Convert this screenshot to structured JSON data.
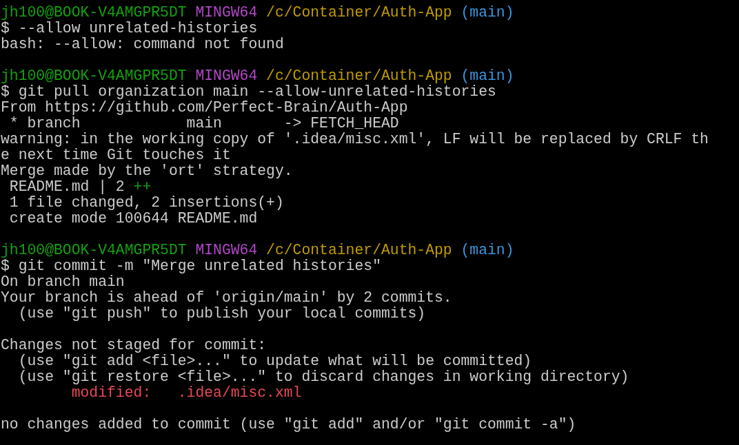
{
  "terminal": {
    "lines": [
      {
        "kind": "prompt",
        "user": "jh100@BOOK-V4AMGPR5DT",
        "system": "MINGW64",
        "path": "/c/Container/Auth-App",
        "branch": "(main)"
      },
      {
        "kind": "command",
        "symbol": "$",
        "text": "--allow unrelated-histories"
      },
      {
        "kind": "output",
        "text": "bash: --allow: command not found"
      },
      {
        "kind": "blank"
      },
      {
        "kind": "prompt",
        "user": "jh100@BOOK-V4AMGPR5DT",
        "system": "MINGW64",
        "path": "/c/Container/Auth-App",
        "branch": "(main)"
      },
      {
        "kind": "command",
        "symbol": "$",
        "text": "git pull organization main --allow-unrelated-histories"
      },
      {
        "kind": "output",
        "text": "From https://github.com/Perfect-Brain/Auth-App"
      },
      {
        "kind": "output",
        "text": " * branch            main       -> FETCH_HEAD"
      },
      {
        "kind": "output",
        "text": "warning: in the working copy of '.idea/misc.xml', LF will be replaced by CRLF th"
      },
      {
        "kind": "output",
        "text": "e next time Git touches it"
      },
      {
        "kind": "output",
        "text": "Merge made by the 'ort' strategy."
      },
      {
        "kind": "stat",
        "text": " README.md | 2",
        "bar": "++"
      },
      {
        "kind": "output",
        "text": " 1 file changed, 2 insertions(+)"
      },
      {
        "kind": "output",
        "text": " create mode 100644 README.md"
      },
      {
        "kind": "blank"
      },
      {
        "kind": "prompt",
        "user": "jh100@BOOK-V4AMGPR5DT",
        "system": "MINGW64",
        "path": "/c/Container/Auth-App",
        "branch": "(main)"
      },
      {
        "kind": "command",
        "symbol": "$",
        "text": "git commit -m \"Merge unrelated histories\""
      },
      {
        "kind": "output",
        "text": "On branch main"
      },
      {
        "kind": "output",
        "text": "Your branch is ahead of 'origin/main' by 2 commits."
      },
      {
        "kind": "output",
        "text": "  (use \"git push\" to publish your local commits)"
      },
      {
        "kind": "blank"
      },
      {
        "kind": "output",
        "text": "Changes not staged for commit:"
      },
      {
        "kind": "output",
        "text": "  (use \"git add <file>...\" to update what will be committed)"
      },
      {
        "kind": "output",
        "text": "  (use \"git restore <file>...\" to discard changes in working directory)"
      },
      {
        "kind": "modified",
        "label": "        modified:",
        "file": ".idea/misc.xml"
      },
      {
        "kind": "blank"
      },
      {
        "kind": "output",
        "text": "no changes added to commit (use \"git add\" and/or \"git commit -a\")"
      }
    ]
  }
}
